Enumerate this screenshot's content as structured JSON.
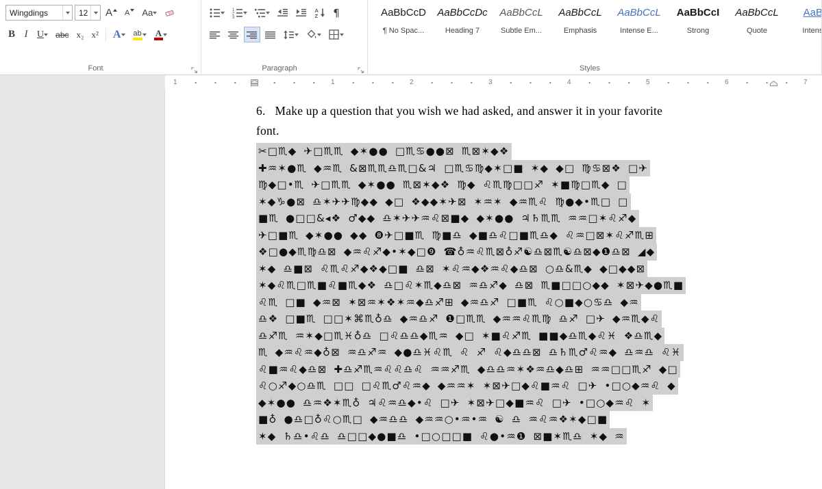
{
  "ribbon": {
    "font": {
      "group_label": "Font",
      "family": "Wingdings",
      "size": "12",
      "grow": "A",
      "shrink": "A",
      "change_case": "Aa",
      "bold": "B",
      "italic": "I",
      "underline": "U",
      "strikethrough": "abc",
      "subscript": "x₂",
      "superscript": "x²",
      "text_effects": "A",
      "highlight": "ab",
      "font_color": "A"
    },
    "paragraph": {
      "group_label": "Paragraph",
      "pilcrow": "¶"
    },
    "styles": {
      "group_label": "Styles",
      "items": [
        {
          "preview": "AaBbCcD",
          "label": "¶ No Spac..."
        },
        {
          "preview": "AaBbCcDc",
          "label": "Heading 7"
        },
        {
          "preview": "AaBbCcL",
          "label": "Subtle Em..."
        },
        {
          "preview": "AaBbCcL",
          "label": "Emphasis"
        },
        {
          "preview": "AaBbCcL",
          "label": "Intense E..."
        },
        {
          "preview": "AaBbCcI",
          "label": "Strong"
        },
        {
          "preview": "AaBbCcL",
          "label": "Quote"
        },
        {
          "preview": "AaBb",
          "label": "Intens..."
        }
      ]
    }
  },
  "ruler": {
    "marks": [
      "1",
      "1",
      "2",
      "3",
      "4",
      "5",
      "6",
      "7"
    ]
  },
  "document": {
    "list_number": "6.",
    "question_line1": "Make up a question that you wish we had asked, and answer it in your favorite",
    "question_line2": "font.",
    "wingdings_lines": [
      "✂□♏◆ ✈□♏♏ ◆✶●● □♏♋●●⊠ ♏⊠✶◆❖",
      "✚♒✶●♏ ◆♒♏ &⊠♏♏♎♏□&♃ □♏♋♍◆✶□■ ✶◆ ◆□ ♍♋⊠❖ □✈",
      "♍◆□•♏ ✈□♏♏ ◆✶●● ♏⊠✶◆❖ ♍◆ ♌♏♍□□♐ ✶■♍□♏◆ □",
      "✶◆♑●⊠ ♎✶✈✈♍◆◆ ◆□ ❖◆◆✶✈⊠ ✶♒✶ ◆♒♏♌ ♍●◆•♏□ □",
      "■♏ ●□□&◂❖ ♂◆◆ ♎✶✈✈♒♌⊠■◆ ◆✶●● ♃♄♏♏ ♒♒□✶♌♐◆",
      "✈□■♏ ◆✶●● ◆◆ ❽✈□■♏ ♍■♎ ◆■♎♌□■♏♎◆ ♌♒□⊠✶♌♐♏⊞",
      "❖□●◆♏♍♎⊠ ◆♒♌♐◆•✶◆□❾ ☎♁♒♌♏⊠♁♐☯♎⊠♏☯♎⊠◆❶♎⊠ ◢◆",
      "✶◆ ♎■⊠ ♌♏♌♐◆❖◆□■ ♎⊠ ✶♌♒◆❖♒♌◆♎⊠ ○♎&♏◆ ◆□◆◆⊠",
      "✶◆♌♏□♏■♌■♏◆❖ ♎□♌✶♏◆♎⊠ ♒♎♐◆ ♎⊠ ♏■□□○◆◆ ✶⊠✈◆●♏■",
      "♌♏ □■ ◆♒⊠ ✶⊠♒✶❖✶♒◆♎♐⊞ ◆♒♎♐ □■♏ ♌○■◆○♋♎ ◆♒",
      "♎❖ □■♏ □□✶⌘♏♁♎ ◆♒♎♐ ❶□♏♏ ◆♒♒♌♏♍ ♎♐ □✈ ◆♒♏◆♌",
      "♎♐♏ ♒✶◆□♏♓♁♎ □♌♎♎◆♏♒ ◆□ ✶■♌♐♏ ■■◆♎♏◆♌♓ ❖♎♏◆",
      "♏ ◆♒♌♒◆♁⊠ ♒♎♐♒ ◆●♎♓♌♏ ♌ ♐ ♌◆♎♎⊠ ♎♄♏♂♌♒◆ ♎♒♎ ♌♓",
      "♌■♒♌◆♎⊠ ✚♎♐♏♒♌♌♎♌ ♒♒♐♏ ◆♎♎♒✶❖♒♎◆♎⊞ ♒♒□□♏♐ ◆□",
      "♌○♐◆○♎♏ □□ □♌♏♂♌♒◆ ◆♒♒✶ ✶⊠✈□◆♌■♒♌ □✈ •□○◆♒♌ ◆",
      "◆✶●● ♎♒❖✶♏♁ ♃♌♒♎◆•♌ □✈ ✶⊠✈□◆■♒♌ □✈ •□○◆♒♌ ✶",
      "■♁ ●♎□♁♌○♏□ ◆♒♎♎ ◆♒♒○•♒•♒ ☯ ♎ ♒♌♒❖✶◆□■",
      "✶◆ ♄♎•♌♎ ♎□□◆●■♎ •□○□□■ ♌●•♒❶ ⊠■✶♏♎ ✶◆ ♒"
    ]
  },
  "colors": {
    "selection_gray": "#cfcfcf",
    "intense_blue": "#4472c4",
    "highlight_yellow": "#ffe600",
    "font_color_red": "#c00000"
  }
}
